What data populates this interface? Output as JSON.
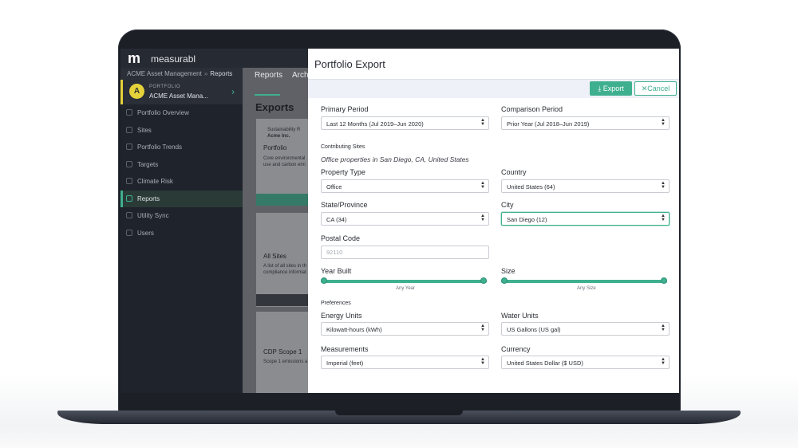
{
  "app": {
    "brand": "measurabl",
    "breadcrumb": [
      "ACME Asset Management",
      "Reports"
    ],
    "breadcrumb_sep": "»"
  },
  "portfolio": {
    "avatar_letter": "A",
    "label": "PORTFOLIO",
    "name": "ACME Asset Mana...",
    "chevron": "›"
  },
  "nav": [
    {
      "label": "Portfolio Overview",
      "icon": "overview-icon"
    },
    {
      "label": "Sites",
      "icon": "sites-icon"
    },
    {
      "label": "Portfolio Trends",
      "icon": "trends-icon"
    },
    {
      "label": "Targets",
      "icon": "targets-icon"
    },
    {
      "label": "Climate Risk",
      "icon": "climate-icon"
    },
    {
      "label": "Reports",
      "icon": "reports-icon",
      "active": true
    },
    {
      "label": "Utility Sync",
      "icon": "sync-icon"
    },
    {
      "label": "Users",
      "icon": "users-icon"
    }
  ],
  "main": {
    "tabs": [
      "Reports",
      "Archi"
    ],
    "title": "Exports",
    "cards": [
      {
        "header": "Sustainability R",
        "org": "Acme Inc.",
        "title": "Portfolio",
        "desc": [
          "Core environmental",
          "use and carbon emi"
        ]
      },
      {
        "title": "All Sites",
        "desc": [
          "A list of all sites in th",
          "compliance informat"
        ]
      },
      {
        "title": "CDP Scope 1",
        "desc": [
          "Scope 1 emissions a"
        ]
      }
    ]
  },
  "modal": {
    "title": "Portfolio Export",
    "export_label": "Export",
    "cancel_label": "Cancel",
    "export_icon": "⤓",
    "cancel_icon": "✕",
    "primary_period": {
      "label": "Primary Period",
      "value": "Last 12 Months (Jul 2019–Jun 2020)"
    },
    "comparison_period": {
      "label": "Comparison Period",
      "value": "Prior Year (Jul 2018–Jun 2019)"
    },
    "contributing_sites": {
      "label": "Contributing Sites",
      "summary": "Office properties in San Diego, CA, United States"
    },
    "property_type": {
      "label": "Property Type",
      "value": "Office"
    },
    "country": {
      "label": "Country",
      "value": "United States (64)"
    },
    "state": {
      "label": "State/Province",
      "value": "CA (34)"
    },
    "city": {
      "label": "City",
      "value": "San Diego (12)"
    },
    "postal_code": {
      "label": "Postal Code",
      "placeholder": "92110"
    },
    "year_built": {
      "label": "Year Built",
      "range_label": "Any Year"
    },
    "size": {
      "label": "Size",
      "range_label": "Any Size"
    },
    "preferences": {
      "label": "Preferences"
    },
    "energy_units": {
      "label": "Energy Units",
      "value": "Kilowatt-hours (kWh)"
    },
    "water_units": {
      "label": "Water Units",
      "value": "US Gallons (US gal)"
    },
    "measurements": {
      "label": "Measurements",
      "value": "Imperial (feet)"
    },
    "currency": {
      "label": "Currency",
      "value": "United States Dollar ($ USD)"
    }
  },
  "colors": {
    "accent": "#3fb08f",
    "sidebar": "#1f232b",
    "avatar": "#e5d23a"
  }
}
